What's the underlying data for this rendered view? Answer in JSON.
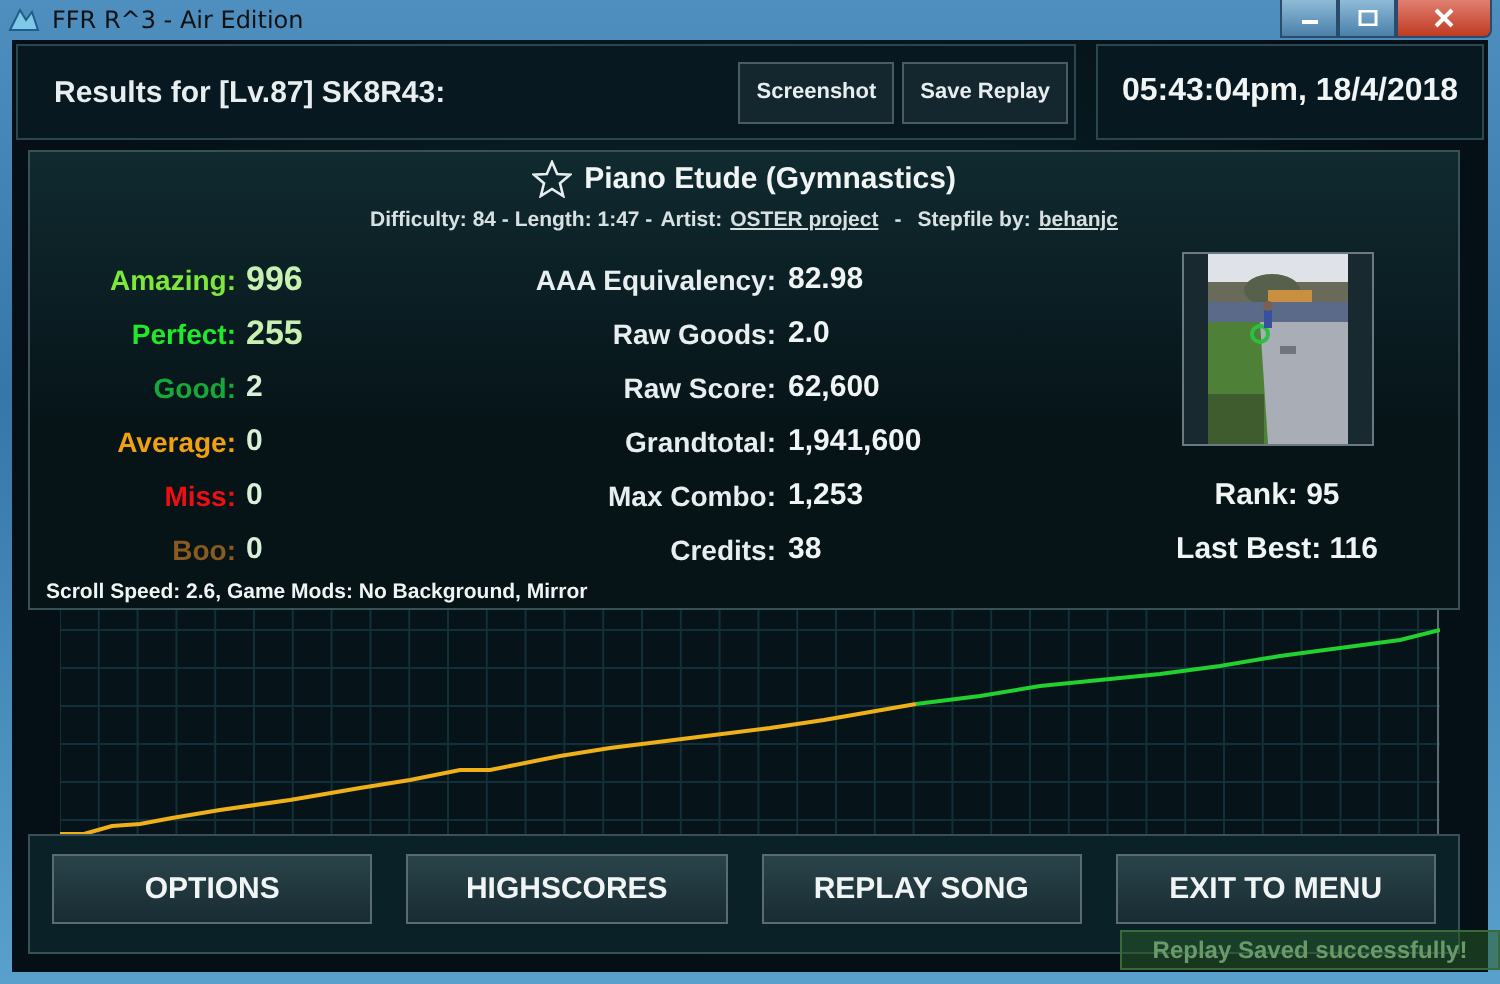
{
  "window": {
    "title": "FFR R^3 - Air Edition"
  },
  "header": {
    "title": "Results for [Lv.87] SK8R43:",
    "buttons": [
      "Screenshot",
      "Save Replay"
    ],
    "datetime": "05:43:04pm, 18/4/2018"
  },
  "song": {
    "title": "Piano Etude (Gymnastics)",
    "favorite": false,
    "difficulty": "Difficulty: 84 - Length: 1:47 -",
    "artist_label": "Artist:",
    "artist": "OSTER project",
    "separator": "-",
    "stepfile_label": "Stepfile by:",
    "stepfile_author": "behanjc"
  },
  "judgments": [
    {
      "label": "Amazing:",
      "value": "996",
      "color": "#7ee83a"
    },
    {
      "label": "Perfect:",
      "value": "255",
      "color": "#22e82c"
    },
    {
      "label": "Good:",
      "value": "2",
      "color": "#17a83a"
    },
    {
      "label": "Average:",
      "value": "0",
      "color": "#f0a010"
    },
    {
      "label": "Miss:",
      "value": "0",
      "color": "#ee1010"
    },
    {
      "label": "Boo:",
      "value": "0",
      "color": "#8a5a1e"
    }
  ],
  "stats": [
    {
      "label": "AAA Equivalency:",
      "value": "82.98"
    },
    {
      "label": "Raw Goods:",
      "value": "2.0"
    },
    {
      "label": "Raw Score:",
      "value": "62,600"
    },
    {
      "label": "Grandtotal:",
      "value": "1,941,600"
    },
    {
      "label": "Max Combo:",
      "value": "1,253"
    },
    {
      "label": "Credits:",
      "value": "38"
    }
  ],
  "side": {
    "rank": "Rank: 95",
    "last_best": "Last Best: 116"
  },
  "settings": "Scroll Speed: 2.6, Game Mods: No Background, Mirror",
  "actions": [
    "OPTIONS",
    "HIGHSCORES",
    "REPLAY SONG",
    "EXIT TO MENU"
  ],
  "toast": "Replay Saved successfully!"
}
